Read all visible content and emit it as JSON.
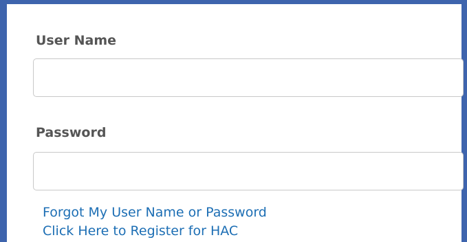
{
  "login_form": {
    "username_label": "User Name",
    "username_value": "",
    "username_placeholder": "",
    "password_label": "Password",
    "password_value": "",
    "password_placeholder": "",
    "forgot_link": "Forgot My User Name or Password",
    "register_link": "Click Here to Register for HAC"
  },
  "colors": {
    "frame_border": "#3e64ad",
    "label_text": "#555555",
    "link_text": "#1c6eb4",
    "input_border": "#c8c8c8"
  }
}
